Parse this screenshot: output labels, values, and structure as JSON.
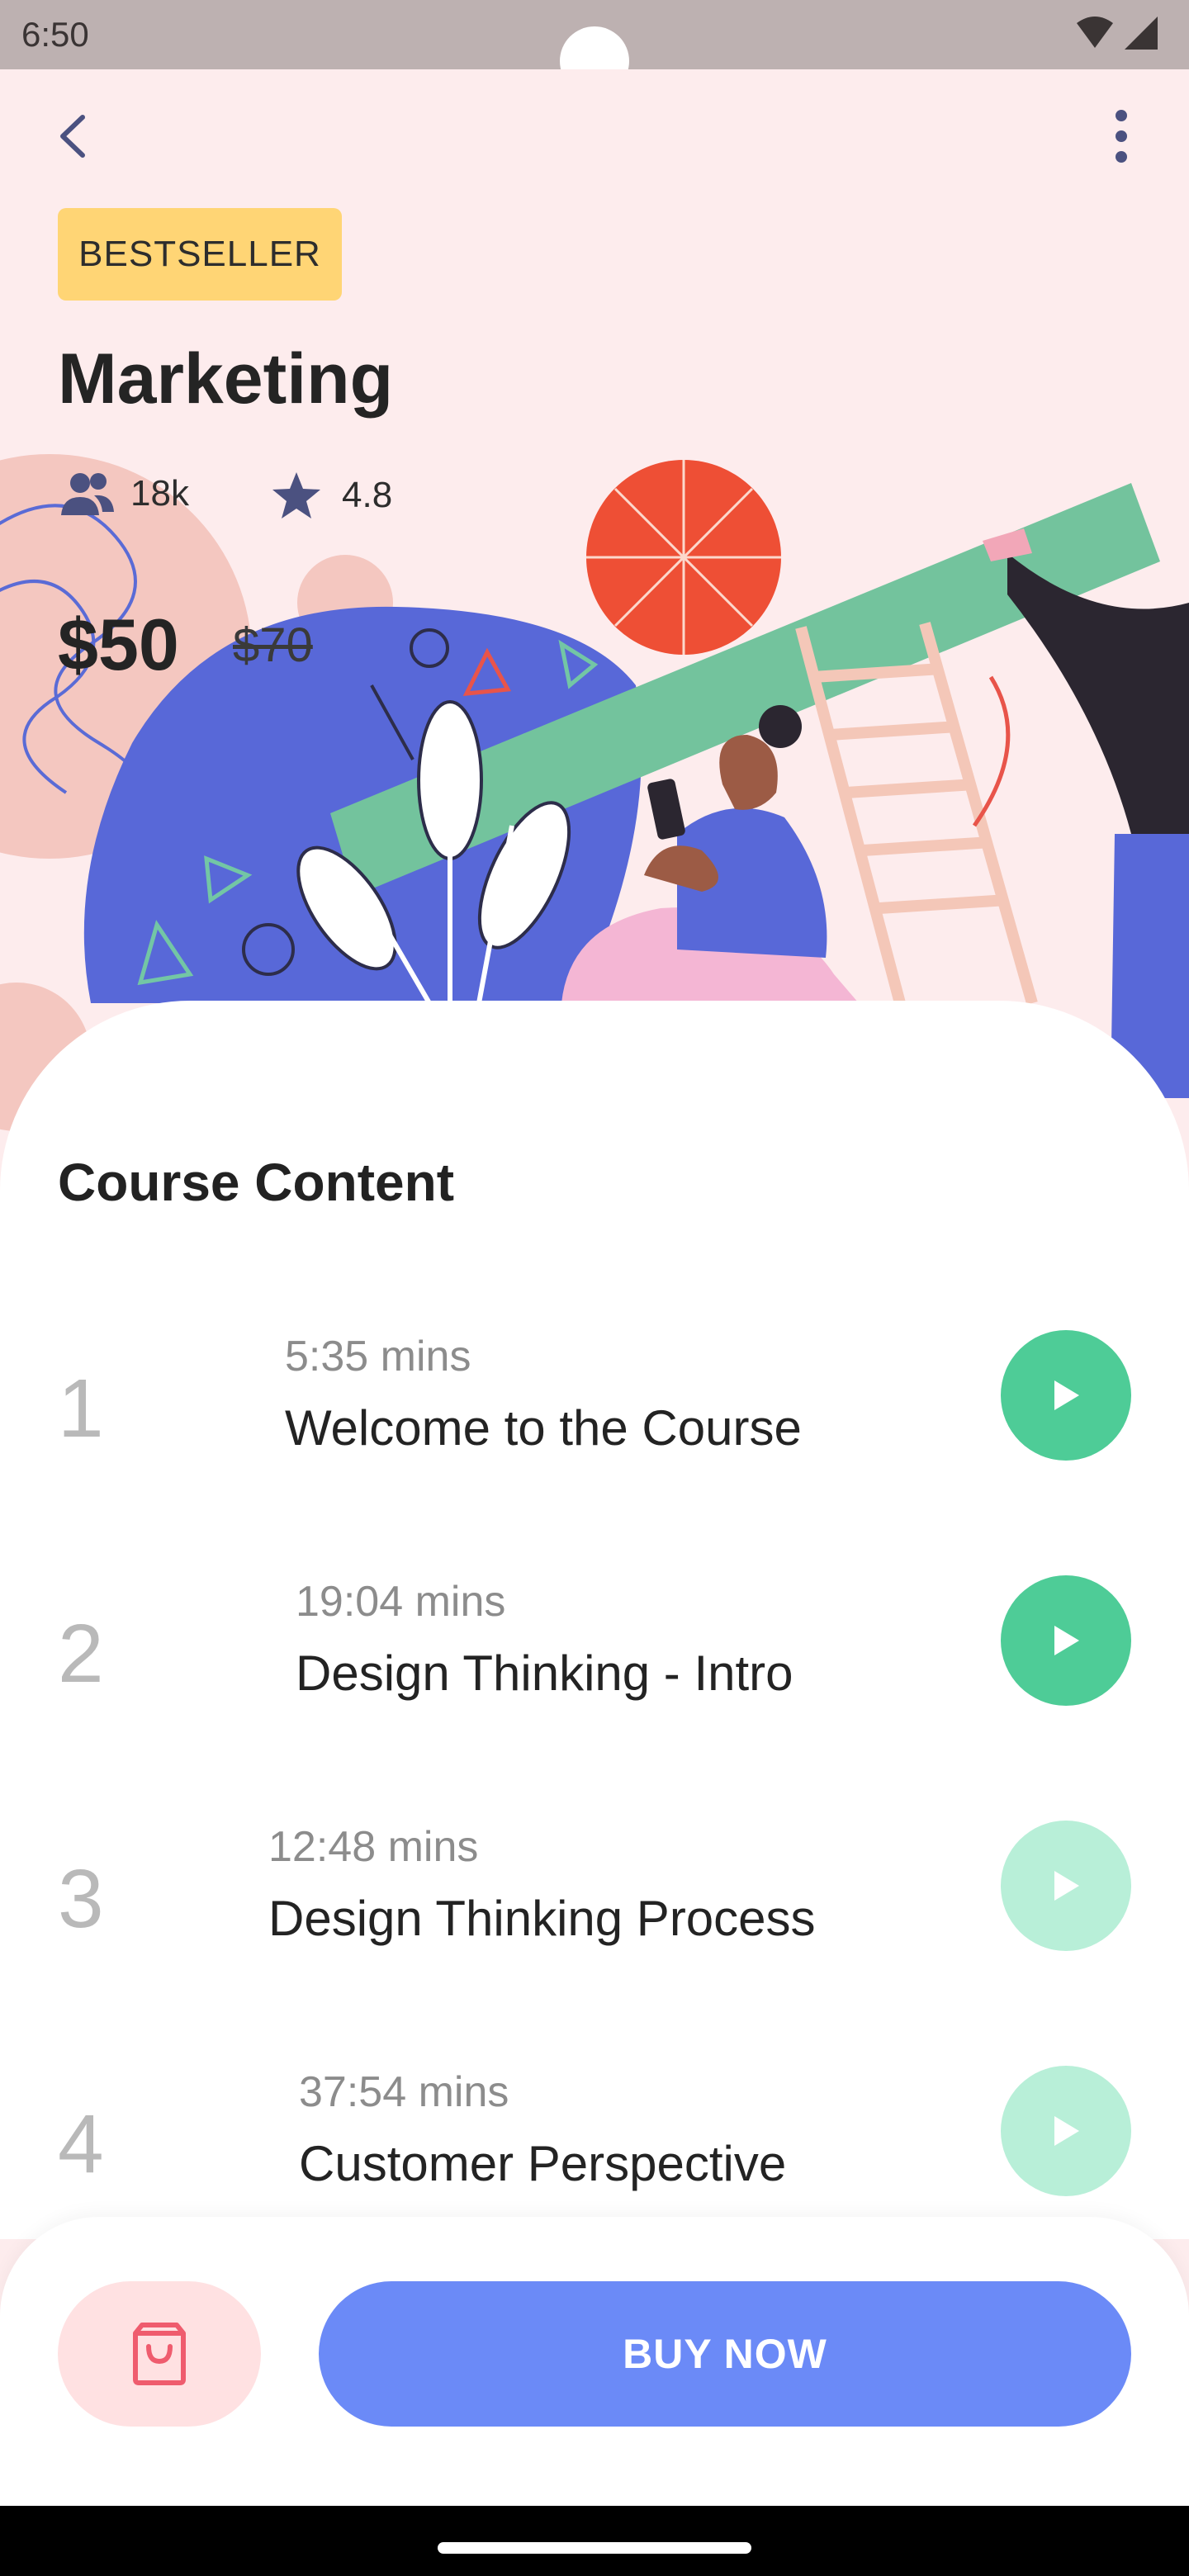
{
  "status": {
    "time": "6:50"
  },
  "course": {
    "badge": "BESTSELLER",
    "title": "Marketing",
    "students": "18k",
    "rating": "4.8",
    "price": "$50",
    "old_price": "$70"
  },
  "content": {
    "section_title": "Course Content",
    "lessons": [
      {
        "number": "1",
        "duration": "5:35 mins",
        "title": "Welcome to the Course",
        "unlocked": true
      },
      {
        "number": "2",
        "duration": "19:04 mins",
        "title": "Design Thinking - Intro",
        "unlocked": true
      },
      {
        "number": "3",
        "duration": "12:48 mins",
        "title": "Design Thinking Process",
        "unlocked": false
      },
      {
        "number": "4",
        "duration": "37:54 mins",
        "title": "Customer Perspective",
        "unlocked": false
      }
    ]
  },
  "actions": {
    "buy_label": "BUY NOW"
  },
  "icons": {
    "back": "chevron-left-icon",
    "more": "more-vertical-icon",
    "students": "people-icon",
    "rating": "star-icon",
    "play": "play-icon",
    "cart": "shopping-bag-icon"
  },
  "colors": {
    "hero_bg": "#fdeced",
    "badge": "#ffd575",
    "play_active": "#4ecc97",
    "play_locked": "#b8efd8",
    "primary": "#6b8af7",
    "cart_bg": "#ffe1e2"
  }
}
